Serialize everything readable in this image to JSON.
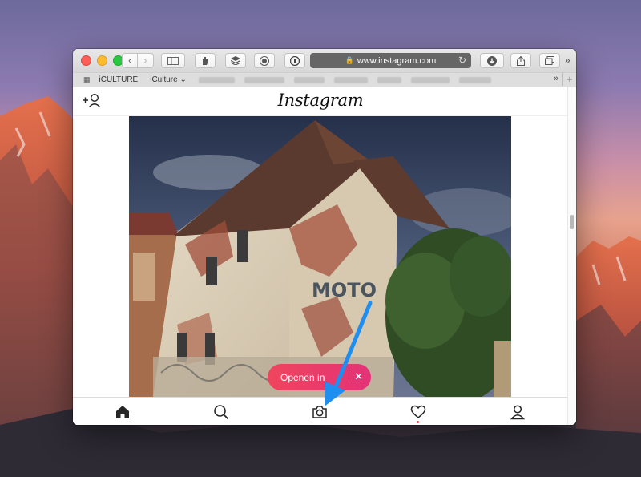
{
  "browser": {
    "url": "www.instagram.com",
    "bookmarks": [
      {
        "label": "iCULTURE"
      },
      {
        "label": "iCulture ⌄"
      }
    ]
  },
  "instagram": {
    "logo": "Instagram",
    "open_app_label": "Openen in",
    "photo_sign_text": "MOTO",
    "nav": [
      "home-icon",
      "search-icon",
      "camera-icon",
      "heart-icon",
      "profile-icon"
    ]
  },
  "colors": {
    "arrow": "#1f8ef1",
    "open_app_button": "#ee3f66",
    "notification_dot": "#ed4956"
  }
}
